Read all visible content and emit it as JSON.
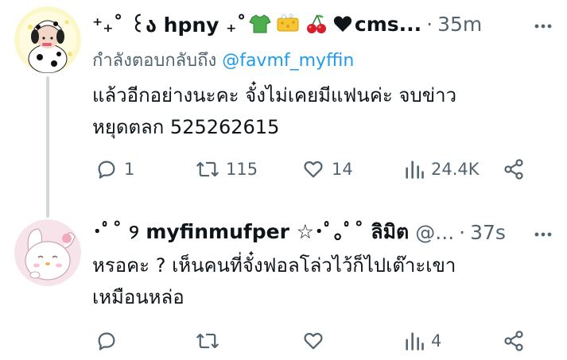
{
  "tweets": [
    {
      "display_name_start": "⁺₊˚ ꒰ა hpny ₊˚",
      "display_name_end": "cms...",
      "time": "35m",
      "replying_to_label": "กำลังตอบกลับถึง",
      "replying_to_handle": "@favmf_myffin",
      "text": "แล้วอีกอย่างนะคะ จั๋งไม่เคยมีแฟนค่ะ จบข่าว\nหยุดตลก 525262615",
      "actions": {
        "reply": "1",
        "retweet": "115",
        "like": "14",
        "views": "24.4K"
      },
      "icons": [
        "tshirt-icon",
        "sponge-icon",
        "cherries-icon",
        "heart-icon"
      ]
    },
    {
      "display_name": "･ﾟ˚ ୨ myfinmufper ☆･ﾟ｡ﾟ˚ ลิมิต",
      "handle": "@...",
      "time": "37s",
      "text": "หรอคะ ? เห็นคนที่จั๋งฟอลโล่วไว้ก็ไปเต๊าะเขา\nเหมือนหล่อ",
      "actions": {
        "reply": "",
        "retweet": "",
        "like": "",
        "views": "4"
      }
    }
  ],
  "separator": "·",
  "colors": {
    "text": "#0f1419",
    "muted": "#536471",
    "link": "#1d9bf0",
    "thread_line": "#cfd9de"
  }
}
